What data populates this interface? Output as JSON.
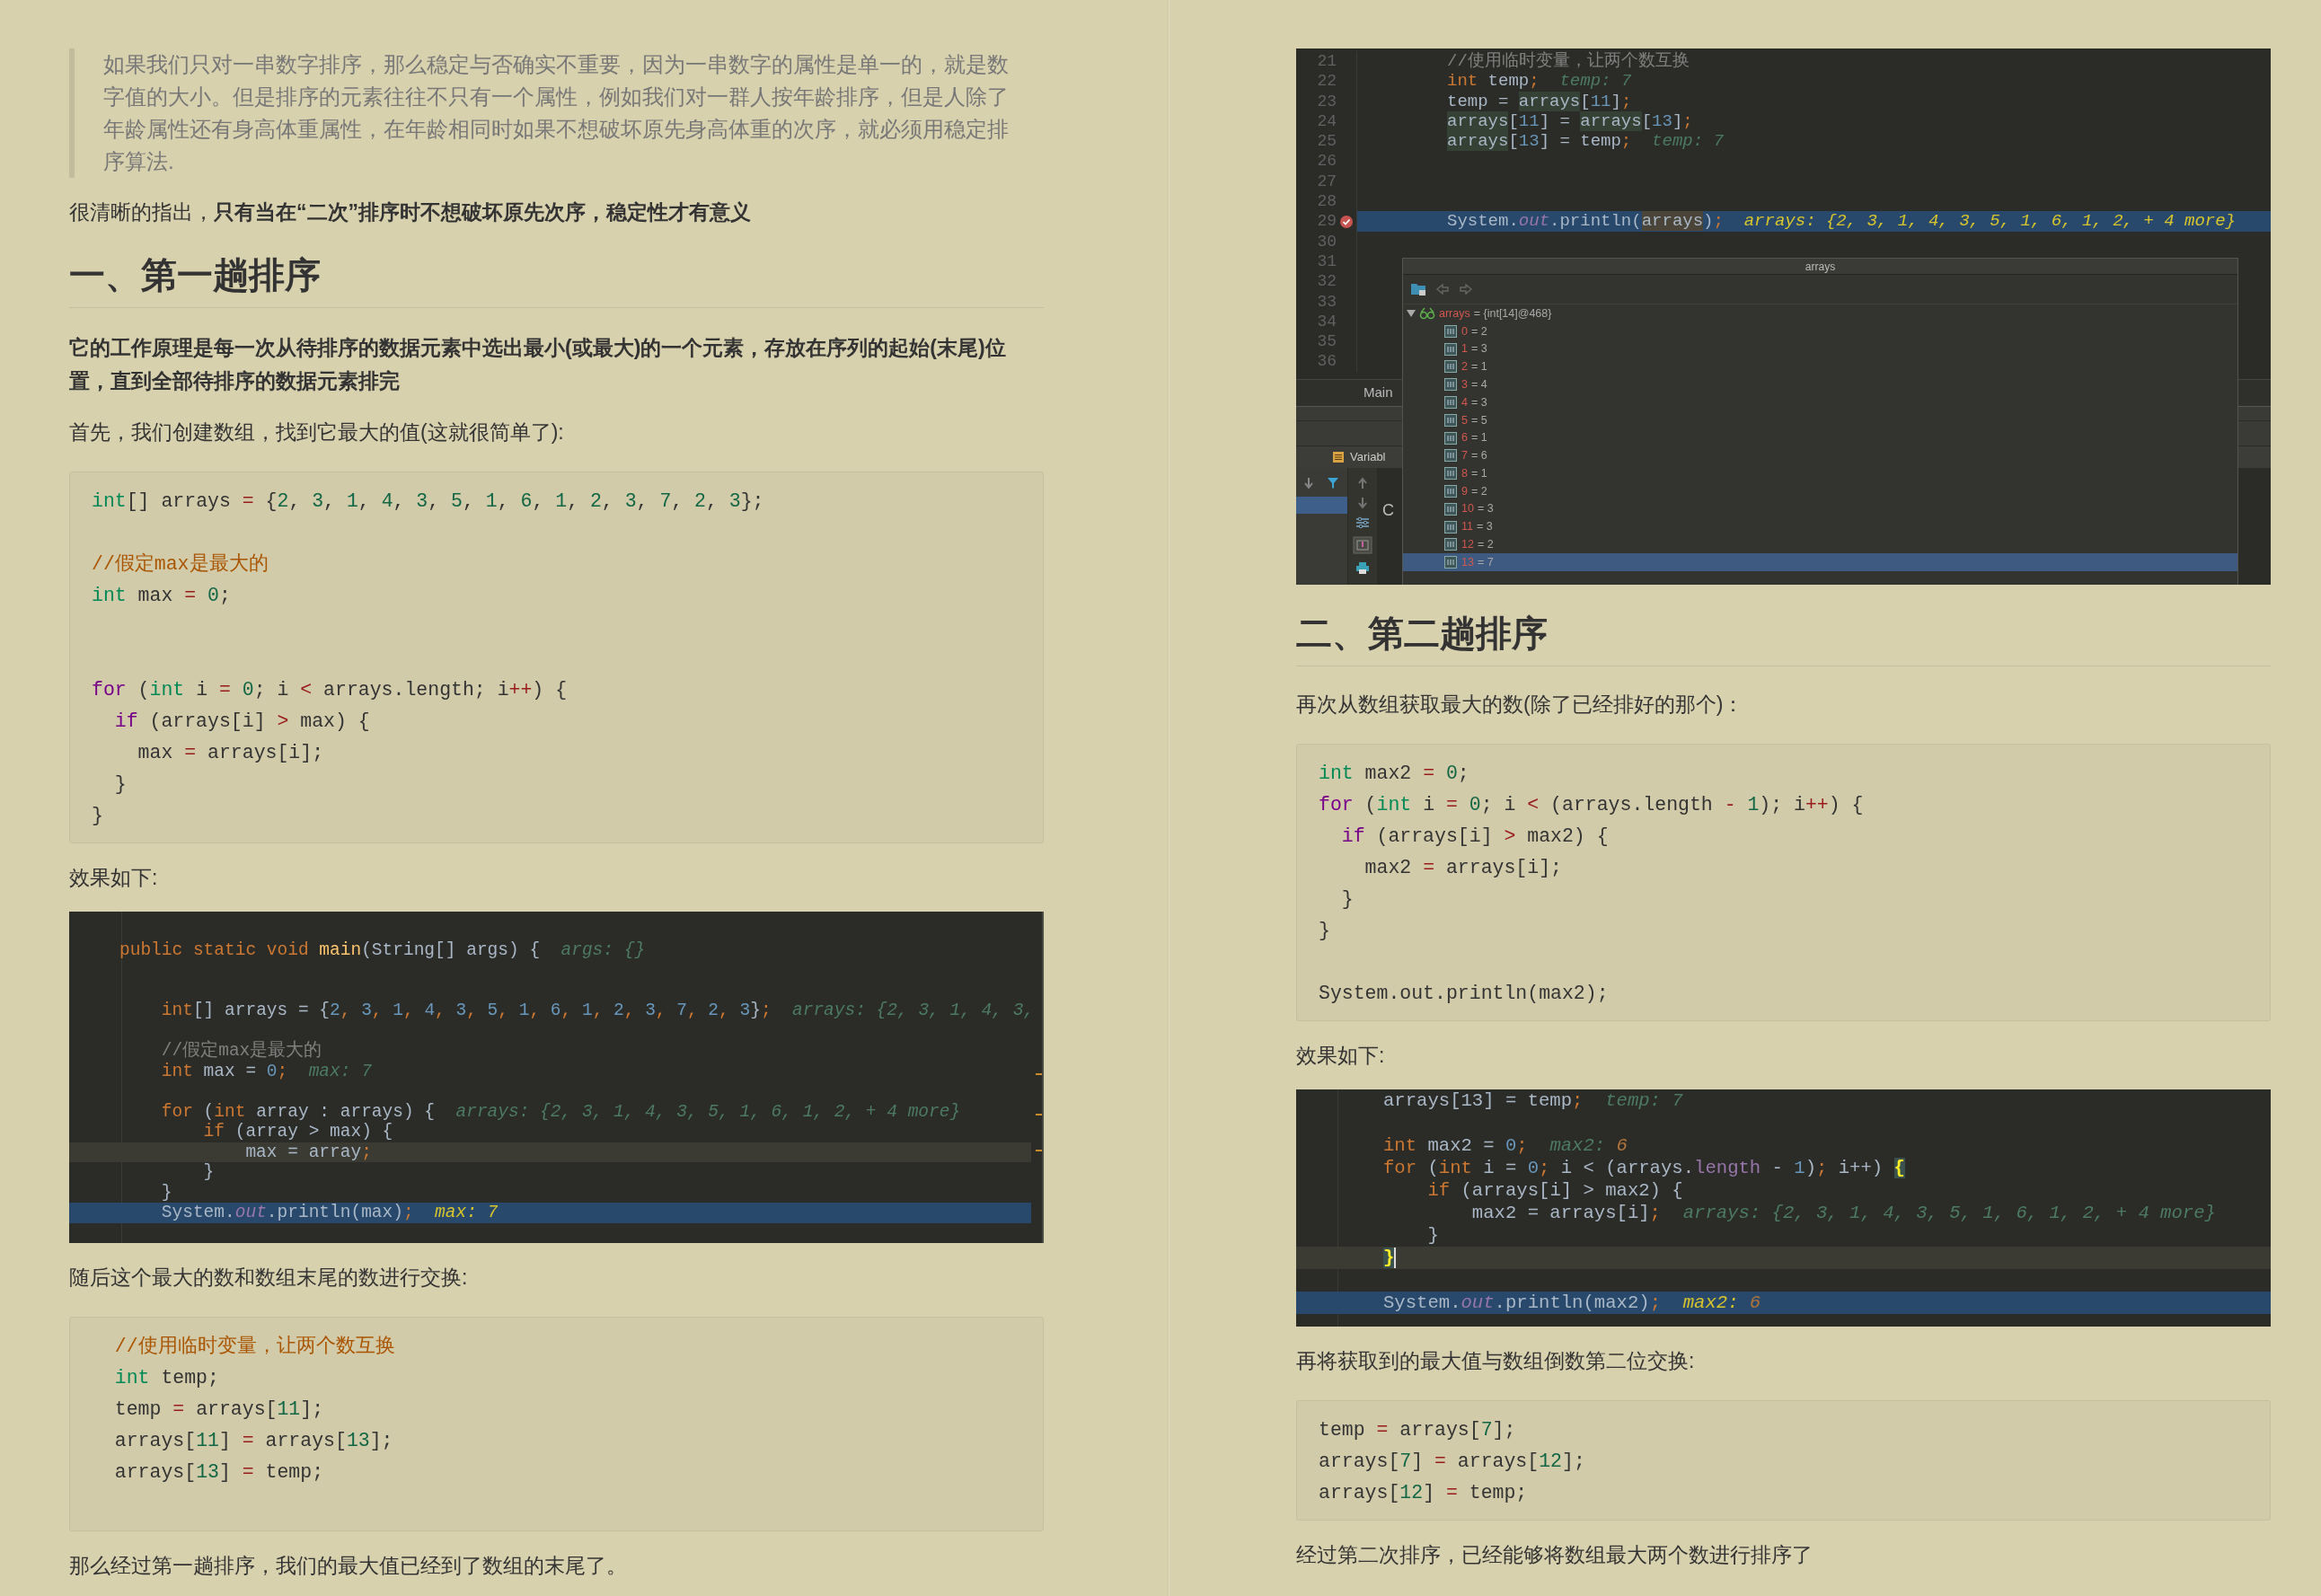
{
  "left": [
    {
      "kind": "quote",
      "text": "如果我们只对一串数字排序，那么稳定与否确实不重要，因为一串数字的属性是单一的，就是数字值的大小。但是排序的元素往往不只有一个属性，例如我们对一群人按年龄排序，但是人除了年龄属性还有身高体重属性，在年龄相同时如果不想破坏原先身高体重的次序，就必须用稳定排序算法."
    },
    {
      "kind": "para",
      "strong": false,
      "text": "很清晰的指出，**只有当在“二次”排序时不想破坏原先次序，稳定性才有意义**"
    },
    {
      "kind": "heading",
      "text": "一、第一趟排序"
    },
    {
      "kind": "para",
      "strong": true,
      "text": "它的工作原理是每一次从待排序的数据元素中选出最小(或最大)的一个元素，存放在序列的起始(末尾)位置，直到全部待排序的数据元素排完"
    },
    {
      "kind": "para",
      "strong": false,
      "text": "首先，我们创建数组，找到它最大的值(这就很简单了):"
    },
    {
      "kind": "code",
      "lines": [
        {
          "kind": "code",
          "tokens": [
            {
              "kind": "type",
              "text": "int"
            },
            {
              "kind": "txt",
              "text": "[] arrays "
            },
            {
              "kind": "op",
              "text": "="
            },
            {
              "kind": "txt",
              "text": " {"
            },
            {
              "kind": "num",
              "text": "2"
            },
            {
              "kind": "txt",
              "text": ", "
            },
            {
              "kind": "num",
              "text": "3"
            },
            {
              "kind": "txt",
              "text": ", "
            },
            {
              "kind": "num",
              "text": "1"
            },
            {
              "kind": "txt",
              "text": ", "
            },
            {
              "kind": "num",
              "text": "4"
            },
            {
              "kind": "txt",
              "text": ", "
            },
            {
              "kind": "num",
              "text": "3"
            },
            {
              "kind": "txt",
              "text": ", "
            },
            {
              "kind": "num",
              "text": "5"
            },
            {
              "kind": "txt",
              "text": ", "
            },
            {
              "kind": "num",
              "text": "1"
            },
            {
              "kind": "txt",
              "text": ", "
            },
            {
              "kind": "num",
              "text": "6"
            },
            {
              "kind": "txt",
              "text": ", "
            },
            {
              "kind": "num",
              "text": "1"
            },
            {
              "kind": "txt",
              "text": ", "
            },
            {
              "kind": "num",
              "text": "2"
            },
            {
              "kind": "txt",
              "text": ", "
            },
            {
              "kind": "num",
              "text": "3"
            },
            {
              "kind": "txt",
              "text": ", "
            },
            {
              "kind": "num",
              "text": "7"
            },
            {
              "kind": "txt",
              "text": ", "
            },
            {
              "kind": "num",
              "text": "2"
            },
            {
              "kind": "txt",
              "text": ", "
            },
            {
              "kind": "num",
              "text": "3"
            },
            {
              "kind": "txt",
              "text": "};"
            }
          ]
        },
        {
          "kind": "blank"
        },
        {
          "kind": "code",
          "tokens": [
            {
              "kind": "com",
              "text": "//假定max是最大的"
            }
          ]
        },
        {
          "kind": "code",
          "tokens": [
            {
              "kind": "type",
              "text": "int"
            },
            {
              "kind": "txt",
              "text": " max "
            },
            {
              "kind": "op",
              "text": "= "
            },
            {
              "kind": "num",
              "text": "0"
            },
            {
              "kind": "txt",
              "text": ";"
            }
          ]
        },
        {
          "kind": "blank"
        },
        {
          "kind": "blank"
        },
        {
          "kind": "code",
          "tokens": [
            {
              "kind": "kw",
              "text": "for"
            },
            {
              "kind": "txt",
              "text": " ("
            },
            {
              "kind": "type",
              "text": "int"
            },
            {
              "kind": "txt",
              "text": " i "
            },
            {
              "kind": "op",
              "text": "= "
            },
            {
              "kind": "num",
              "text": "0"
            },
            {
              "kind": "txt",
              "text": "; i "
            },
            {
              "kind": "op",
              "text": "<"
            },
            {
              "kind": "txt",
              "text": " arrays.length; i"
            },
            {
              "kind": "op",
              "text": "++"
            },
            {
              "kind": "txt",
              "text": ") {"
            }
          ]
        },
        {
          "kind": "code",
          "tokens": [
            {
              "kind": "kw",
              "text": "  if"
            },
            {
              "kind": "txt",
              "text": " (arrays[i] "
            },
            {
              "kind": "op",
              "text": ">"
            },
            {
              "kind": "txt",
              "text": " max) {"
            }
          ]
        },
        {
          "kind": "code",
          "tokens": [
            {
              "kind": "txt",
              "text": "    max "
            },
            {
              "kind": "op",
              "text": "="
            },
            {
              "kind": "txt",
              "text": " arrays[i];"
            }
          ]
        },
        {
          "kind": "code",
          "tokens": [
            {
              "kind": "txt",
              "text": "  }"
            }
          ]
        },
        {
          "kind": "code",
          "tokens": [
            {
              "kind": "txt",
              "text": "}"
            }
          ]
        }
      ]
    },
    {
      "kind": "para",
      "strong": false,
      "text": "效果如下:"
    },
    {
      "kind": "ide_editor",
      "lines": [
        {
          "kind": "blank",
          "current": false,
          "paused": false
        },
        {
          "kind": "code",
          "current": false,
          "paused": false,
          "tokens": [
            {
              "kind": "kw",
              "text": "public static void "
            },
            {
              "kind": "fn",
              "text": "main"
            },
            {
              "kind": "txt",
              "text": "(String[] args) {  "
            },
            {
              "kind": "hint",
              "text": "args: {}"
            }
          ]
        },
        {
          "kind": "blank",
          "current": false,
          "paused": false
        },
        {
          "kind": "blank",
          "current": false,
          "paused": false
        },
        {
          "kind": "code",
          "current": false,
          "paused": false,
          "tokens": [
            {
              "kind": "kw",
              "text": "    int"
            },
            {
              "kind": "txt",
              "text": "[] arrays = {"
            },
            {
              "kind": "num",
              "text": "2"
            },
            {
              "kind": "kw",
              "text": ", "
            },
            {
              "kind": "num",
              "text": "3"
            },
            {
              "kind": "kw",
              "text": ", "
            },
            {
              "kind": "num",
              "text": "1"
            },
            {
              "kind": "kw",
              "text": ", "
            },
            {
              "kind": "num",
              "text": "4"
            },
            {
              "kind": "kw",
              "text": ", "
            },
            {
              "kind": "num",
              "text": "3"
            },
            {
              "kind": "kw",
              "text": ", "
            },
            {
              "kind": "num",
              "text": "5"
            },
            {
              "kind": "kw",
              "text": ", "
            },
            {
              "kind": "num",
              "text": "1"
            },
            {
              "kind": "kw",
              "text": ", "
            },
            {
              "kind": "num",
              "text": "6"
            },
            {
              "kind": "kw",
              "text": ", "
            },
            {
              "kind": "num",
              "text": "1"
            },
            {
              "kind": "kw",
              "text": ", "
            },
            {
              "kind": "num",
              "text": "2"
            },
            {
              "kind": "kw",
              "text": ", "
            },
            {
              "kind": "num",
              "text": "3"
            },
            {
              "kind": "kw",
              "text": ", "
            },
            {
              "kind": "num",
              "text": "7"
            },
            {
              "kind": "kw",
              "text": ", "
            },
            {
              "kind": "num",
              "text": "2"
            },
            {
              "kind": "kw",
              "text": ", "
            },
            {
              "kind": "num",
              "text": "3"
            },
            {
              "kind": "txt",
              "text": "}"
            },
            {
              "kind": "kw",
              "text": ";  "
            },
            {
              "kind": "hint",
              "text": "arrays: {2, 3, 1, 4, 3,"
            }
          ]
        },
        {
          "kind": "blank",
          "current": false,
          "paused": false
        },
        {
          "kind": "code",
          "current": false,
          "paused": false,
          "tokens": [
            {
              "kind": "com",
              "text": "    //假定max是最大的"
            }
          ]
        },
        {
          "kind": "code",
          "current": false,
          "paused": false,
          "tokens": [
            {
              "kind": "kw",
              "text": "    int"
            },
            {
              "kind": "txt",
              "text": " max = "
            },
            {
              "kind": "num",
              "text": "0"
            },
            {
              "kind": "kw",
              "text": ";  "
            },
            {
              "kind": "hint",
              "text": "max: 7"
            }
          ]
        },
        {
          "kind": "blank",
          "current": false,
          "paused": false
        },
        {
          "kind": "code",
          "current": false,
          "paused": false,
          "tokens": [
            {
              "kind": "kw",
              "text": "    for"
            },
            {
              "kind": "txt",
              "text": " ("
            },
            {
              "kind": "kw",
              "text": "int"
            },
            {
              "kind": "txt",
              "text": " array : arrays) {  "
            },
            {
              "kind": "hint",
              "text": "arrays: {2, 3, 1, 4, 3, 5, 1, 6, 1, 2, + 4 more}"
            }
          ]
        },
        {
          "kind": "code",
          "current": false,
          "paused": false,
          "tokens": [
            {
              "kind": "kw",
              "text": "        if"
            },
            {
              "kind": "txt",
              "text": " (array > max) {"
            }
          ]
        },
        {
          "kind": "code",
          "current": true,
          "paused": false,
          "tokens": [
            {
              "kind": "txt",
              "text": "            max = array"
            },
            {
              "kind": "kw",
              "text": ";"
            }
          ]
        },
        {
          "kind": "code",
          "current": false,
          "paused": false,
          "tokens": [
            {
              "kind": "txt",
              "text": "        }"
            }
          ]
        },
        {
          "kind": "code",
          "current": false,
          "paused": false,
          "tokens": [
            {
              "kind": "txt",
              "text": "    }"
            }
          ]
        },
        {
          "kind": "code",
          "current": false,
          "paused": true,
          "tokens": [
            {
              "kind": "txt",
              "text": "    System."
            },
            {
              "kind": "field",
              "text": "out"
            },
            {
              "kind": "txt",
              "text": ".println(max)"
            },
            {
              "kind": "kw",
              "text": ";  "
            },
            {
              "kind": "hintv",
              "text": "max: 7"
            }
          ]
        },
        {
          "kind": "blank",
          "current": false,
          "paused": false
        }
      ]
    },
    {
      "kind": "para",
      "strong": false,
      "text": "随后这个最大的数和数组末尾的数进行交换:"
    },
    {
      "kind": "code",
      "lines": [
        {
          "kind": "code",
          "tokens": [
            {
              "kind": "com",
              "text": "  //使用临时变量，让两个数互换"
            }
          ]
        },
        {
          "kind": "code",
          "tokens": [
            {
              "kind": "type",
              "text": "  int"
            },
            {
              "kind": "txt",
              "text": " temp;"
            }
          ]
        },
        {
          "kind": "code",
          "tokens": [
            {
              "kind": "txt",
              "text": "  temp "
            },
            {
              "kind": "op",
              "text": "="
            },
            {
              "kind": "txt",
              "text": " arrays["
            },
            {
              "kind": "num",
              "text": "11"
            },
            {
              "kind": "txt",
              "text": "];"
            }
          ]
        },
        {
          "kind": "code",
          "tokens": [
            {
              "kind": "txt",
              "text": "  arrays["
            },
            {
              "kind": "num",
              "text": "11"
            },
            {
              "kind": "txt",
              "text": "] "
            },
            {
              "kind": "op",
              "text": "="
            },
            {
              "kind": "txt",
              "text": " arrays["
            },
            {
              "kind": "num",
              "text": "13"
            },
            {
              "kind": "txt",
              "text": "];"
            }
          ]
        },
        {
          "kind": "code",
          "tokens": [
            {
              "kind": "txt",
              "text": "  arrays["
            },
            {
              "kind": "num",
              "text": "13"
            },
            {
              "kind": "txt",
              "text": "] "
            },
            {
              "kind": "op",
              "text": "="
            },
            {
              "kind": "txt",
              "text": " temp;"
            }
          ]
        },
        {
          "kind": "blank"
        }
      ]
    },
    {
      "kind": "para",
      "strong": false,
      "text": "那么经过第一趟排序，我们的最大值已经到了数组的末尾了。"
    }
  ],
  "right": [
    {
      "kind": "ide_debugger",
      "lines": [
        {
          "kind": "code",
          "number": "21",
          "breakpoint": false,
          "current": false,
          "paused": false,
          "tokens": [
            {
              "kind": "com",
              "text": "//使用临时变量，让两个数互换"
            }
          ]
        },
        {
          "kind": "code",
          "number": "22",
          "breakpoint": false,
          "current": false,
          "paused": false,
          "tokens": [
            {
              "kind": "kw",
              "text": "int"
            },
            {
              "kind": "txt",
              "text": " temp"
            },
            {
              "kind": "kw",
              "text": ";  "
            },
            {
              "kind": "hint",
              "text": "temp: 7"
            }
          ]
        },
        {
          "kind": "code",
          "number": "23",
          "breakpoint": false,
          "current": false,
          "paused": false,
          "tokens": [
            {
              "kind": "txt",
              "text": "temp = "
            },
            {
              "kind": "use",
              "text": "arrays"
            },
            {
              "kind": "txt",
              "text": "["
            },
            {
              "kind": "num",
              "text": "11"
            },
            {
              "kind": "txt",
              "text": "]"
            },
            {
              "kind": "kw",
              "text": ";"
            }
          ]
        },
        {
          "kind": "code",
          "number": "24",
          "breakpoint": false,
          "current": false,
          "paused": false,
          "tokens": [
            {
              "kind": "use",
              "text": "arrays"
            },
            {
              "kind": "txt",
              "text": "["
            },
            {
              "kind": "num",
              "text": "11"
            },
            {
              "kind": "txt",
              "text": "] = "
            },
            {
              "kind": "use",
              "text": "arrays"
            },
            {
              "kind": "txt",
              "text": "["
            },
            {
              "kind": "num",
              "text": "13"
            },
            {
              "kind": "txt",
              "text": "]"
            },
            {
              "kind": "kw",
              "text": ";"
            }
          ]
        },
        {
          "kind": "code",
          "number": "25",
          "breakpoint": false,
          "current": false,
          "paused": false,
          "tokens": [
            {
              "kind": "use",
              "text": "arrays"
            },
            {
              "kind": "txt",
              "text": "["
            },
            {
              "kind": "num",
              "text": "13"
            },
            {
              "kind": "txt",
              "text": "] = temp"
            },
            {
              "kind": "kw",
              "text": ";  "
            },
            {
              "kind": "hint",
              "text": "temp: 7"
            }
          ]
        },
        {
          "kind": "blank",
          "number": "26",
          "breakpoint": false,
          "current": false,
          "paused": false
        },
        {
          "kind": "blank",
          "number": "27",
          "breakpoint": false,
          "current": false,
          "paused": false
        },
        {
          "kind": "blank",
          "number": "28",
          "breakpoint": false,
          "current": false,
          "paused": false
        },
        {
          "kind": "code",
          "number": "29",
          "breakpoint": true,
          "current": false,
          "paused": true,
          "tokens": [
            {
              "kind": "txt",
              "text": "System."
            },
            {
              "kind": "field",
              "text": "out"
            },
            {
              "kind": "txt",
              "text": ".println("
            },
            {
              "kind": "usesel",
              "text": "arrays"
            },
            {
              "kind": "txt",
              "text": ")"
            },
            {
              "kind": "kw",
              "text": ";  "
            },
            {
              "kind": "hintv",
              "text": "arrays: {2, 3, 1, 4, 3, 5, 1, 6, 1, 2, + 4 more}"
            }
          ]
        },
        {
          "kind": "blank",
          "number": "30",
          "breakpoint": false,
          "current": false,
          "paused": false
        },
        {
          "kind": "blank",
          "number": "31",
          "breakpoint": false,
          "current": false,
          "paused": false
        },
        {
          "kind": "blank",
          "number": "32",
          "breakpoint": false,
          "current": false,
          "paused": false
        },
        {
          "kind": "blank",
          "number": "33",
          "breakpoint": false,
          "current": false,
          "paused": false
        },
        {
          "kind": "blank",
          "number": "34",
          "breakpoint": false,
          "current": false,
          "paused": false
        },
        {
          "kind": "blank",
          "number": "35",
          "breakpoint": false,
          "current": false,
          "paused": false
        },
        {
          "kind": "blank",
          "number": "36",
          "breakpoint": false,
          "current": false,
          "paused": false
        }
      ],
      "breadcrumb": "Main",
      "tool_tab": "Variabl",
      "console_fragment": "C",
      "popup": {
        "title": "arrays",
        "root": {
          "name": "arrays",
          "value": "= {int[14]@468}",
          "expanded": true
        },
        "items": [
          {
            "name": "0",
            "value": "= 2",
            "selected": false
          },
          {
            "name": "1",
            "value": "= 3",
            "selected": false
          },
          {
            "name": "2",
            "value": "= 1",
            "selected": false
          },
          {
            "name": "3",
            "value": "= 4",
            "selected": false
          },
          {
            "name": "4",
            "value": "= 3",
            "selected": false
          },
          {
            "name": "5",
            "value": "= 5",
            "selected": false
          },
          {
            "name": "6",
            "value": "= 1",
            "selected": false
          },
          {
            "name": "7",
            "value": "= 6",
            "selected": false
          },
          {
            "name": "8",
            "value": "= 1",
            "selected": false
          },
          {
            "name": "9",
            "value": "= 2",
            "selected": false
          },
          {
            "name": "10",
            "value": "= 3",
            "selected": false
          },
          {
            "name": "11",
            "value": "= 3",
            "selected": false
          },
          {
            "name": "12",
            "value": "= 2",
            "selected": false
          },
          {
            "name": "13",
            "value": "= 7",
            "selected": true
          }
        ]
      }
    },
    {
      "kind": "heading",
      "text": "二、第二趟排序"
    },
    {
      "kind": "para",
      "strong": false,
      "text": "再次从数组获取最大的数(除了已经排好的那个)："
    },
    {
      "kind": "code",
      "lines": [
        {
          "kind": "code",
          "tokens": [
            {
              "kind": "type",
              "text": "int"
            },
            {
              "kind": "txt",
              "text": " max2 "
            },
            {
              "kind": "op",
              "text": "= "
            },
            {
              "kind": "num",
              "text": "0"
            },
            {
              "kind": "txt",
              "text": ";"
            }
          ]
        },
        {
          "kind": "code",
          "tokens": [
            {
              "kind": "kw",
              "text": "for"
            },
            {
              "kind": "txt",
              "text": " ("
            },
            {
              "kind": "type",
              "text": "int"
            },
            {
              "kind": "txt",
              "text": " i "
            },
            {
              "kind": "op",
              "text": "= "
            },
            {
              "kind": "num",
              "text": "0"
            },
            {
              "kind": "txt",
              "text": "; i "
            },
            {
              "kind": "op",
              "text": "<"
            },
            {
              "kind": "txt",
              "text": " (arrays.length "
            },
            {
              "kind": "op",
              "text": "- "
            },
            {
              "kind": "num",
              "text": "1"
            },
            {
              "kind": "txt",
              "text": "); i"
            },
            {
              "kind": "op",
              "text": "++"
            },
            {
              "kind": "txt",
              "text": ") {"
            }
          ]
        },
        {
          "kind": "code",
          "tokens": [
            {
              "kind": "kw",
              "text": "  if"
            },
            {
              "kind": "txt",
              "text": " (arrays[i] "
            },
            {
              "kind": "op",
              "text": ">"
            },
            {
              "kind": "txt",
              "text": " max2) {"
            }
          ]
        },
        {
          "kind": "code",
          "tokens": [
            {
              "kind": "txt",
              "text": "    max2 "
            },
            {
              "kind": "op",
              "text": "="
            },
            {
              "kind": "txt",
              "text": " arrays[i];"
            }
          ]
        },
        {
          "kind": "code",
          "tokens": [
            {
              "kind": "txt",
              "text": "  }"
            }
          ]
        },
        {
          "kind": "code",
          "tokens": [
            {
              "kind": "txt",
              "text": "}"
            }
          ]
        },
        {
          "kind": "blank"
        },
        {
          "kind": "code",
          "tokens": [
            {
              "kind": "txt",
              "text": "System.out.println(max2);"
            }
          ]
        }
      ]
    },
    {
      "kind": "para",
      "strong": false,
      "text": "效果如下:"
    },
    {
      "kind": "ide_editor",
      "lines": [
        {
          "kind": "code",
          "current": false,
          "paused": false,
          "tokens": [
            {
              "kind": "txt",
              "text": "arrays[13] = temp"
            },
            {
              "kind": "kw",
              "text": ";  "
            },
            {
              "kind": "hint",
              "text": "temp: 7"
            }
          ]
        },
        {
          "kind": "blank",
          "current": false,
          "paused": false
        },
        {
          "kind": "code",
          "current": false,
          "paused": false,
          "tokens": [
            {
              "kind": "kw",
              "text": "int"
            },
            {
              "kind": "txt",
              "text": " max2 = "
            },
            {
              "kind": "num",
              "text": "0"
            },
            {
              "kind": "kw",
              "text": ";  "
            },
            {
              "kind": "hint",
              "text": "max2: "
            },
            {
              "kind": "hintn",
              "text": "6"
            }
          ]
        },
        {
          "kind": "code",
          "current": false,
          "paused": false,
          "tokens": [
            {
              "kind": "kw",
              "text": "for"
            },
            {
              "kind": "txt",
              "text": " ("
            },
            {
              "kind": "kw",
              "text": "int"
            },
            {
              "kind": "txt",
              "text": " i = "
            },
            {
              "kind": "num",
              "text": "0"
            },
            {
              "kind": "kw",
              "text": "; "
            },
            {
              "kind": "txt",
              "text": "i < (arrays."
            },
            {
              "kind": "prop",
              "text": "length"
            },
            {
              "kind": "txt",
              "text": " - "
            },
            {
              "kind": "num",
              "text": "1"
            },
            {
              "kind": "txt",
              "text": ")"
            },
            {
              "kind": "kw",
              "text": "; "
            },
            {
              "kind": "txt",
              "text": "i++) "
            },
            {
              "kind": "brace",
              "text": "{"
            }
          ]
        },
        {
          "kind": "code",
          "current": false,
          "paused": false,
          "tokens": [
            {
              "kind": "kw",
              "text": "    if"
            },
            {
              "kind": "txt",
              "text": " (arrays[i] > max2) {"
            }
          ]
        },
        {
          "kind": "code",
          "current": false,
          "paused": false,
          "tokens": [
            {
              "kind": "txt",
              "text": "        max2 = arrays[i]"
            },
            {
              "kind": "kw",
              "text": ";  "
            },
            {
              "kind": "hint",
              "text": "arrays: {2, 3, 1, 4, 3, 5, 1, 6, 1, 2, + 4 more}"
            }
          ]
        },
        {
          "kind": "code",
          "current": false,
          "paused": false,
          "tokens": [
            {
              "kind": "txt",
              "text": "    }"
            }
          ]
        },
        {
          "kind": "code",
          "current": true,
          "paused": false,
          "tokens": [
            {
              "kind": "bracecur",
              "text": "}"
            }
          ]
        },
        {
          "kind": "blank",
          "current": false,
          "paused": false
        },
        {
          "kind": "code",
          "current": false,
          "paused": true,
          "tokens": [
            {
              "kind": "txt",
              "text": "System."
            },
            {
              "kind": "field",
              "text": "out"
            },
            {
              "kind": "txt",
              "text": ".println(max2)"
            },
            {
              "kind": "kw",
              "text": ";  "
            },
            {
              "kind": "hintv",
              "text": "max2: "
            },
            {
              "kind": "hintn",
              "text": "6"
            }
          ]
        },
        {
          "kind": "blank",
          "current": false,
          "paused": false
        }
      ]
    },
    {
      "kind": "para",
      "strong": false,
      "text": "再将获取到的最大值与数组倒数第二位交换:"
    },
    {
      "kind": "code",
      "lines": [
        {
          "kind": "code",
          "tokens": [
            {
              "kind": "txt",
              "text": "temp "
            },
            {
              "kind": "op",
              "text": "="
            },
            {
              "kind": "txt",
              "text": " arrays["
            },
            {
              "kind": "num",
              "text": "7"
            },
            {
              "kind": "txt",
              "text": "];"
            }
          ]
        },
        {
          "kind": "code",
          "tokens": [
            {
              "kind": "txt",
              "text": "arrays["
            },
            {
              "kind": "num",
              "text": "7"
            },
            {
              "kind": "txt",
              "text": "] "
            },
            {
              "kind": "op",
              "text": "="
            },
            {
              "kind": "txt",
              "text": " arrays["
            },
            {
              "kind": "num",
              "text": "12"
            },
            {
              "kind": "txt",
              "text": "];"
            }
          ]
        },
        {
          "kind": "code",
          "tokens": [
            {
              "kind": "txt",
              "text": "arrays["
            },
            {
              "kind": "num",
              "text": "12"
            },
            {
              "kind": "txt",
              "text": "] "
            },
            {
              "kind": "op",
              "text": "="
            },
            {
              "kind": "txt",
              "text": " temp;"
            }
          ]
        }
      ]
    },
    {
      "kind": "para",
      "strong": false,
      "text": "经过第二次排序，已经能够将数组最大两个数进行排序了"
    }
  ]
}
